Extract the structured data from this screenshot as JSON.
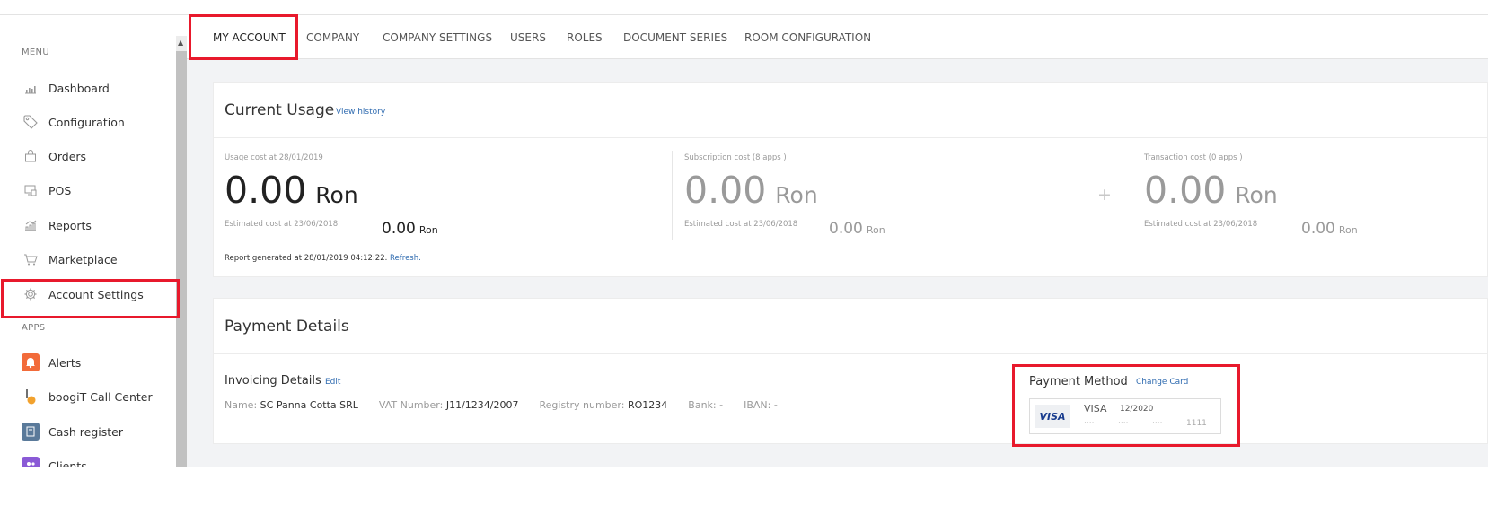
{
  "sidebar": {
    "menu_label": "MENU",
    "items": [
      {
        "label": "Dashboard",
        "icon": "bar-chart-icon"
      },
      {
        "label": "Configuration",
        "icon": "tag-icon"
      },
      {
        "label": "Orders",
        "icon": "shopping-bag-icon"
      },
      {
        "label": "POS",
        "icon": "pos-terminal-icon"
      },
      {
        "label": "Reports",
        "icon": "reports-chart-icon"
      },
      {
        "label": "Marketplace",
        "icon": "cart-icon"
      },
      {
        "label": "Account Settings",
        "icon": "gear-icon"
      }
    ],
    "apps_label": "APPS",
    "apps": [
      {
        "label": "Alerts",
        "icon": "bell-icon",
        "color": "#f26b3a"
      },
      {
        "label": "boogiT Call Center",
        "icon": "phone-icon",
        "color": "#f2a22e"
      },
      {
        "label": "Cash register",
        "icon": "cash-register-icon",
        "color": "#5a7a9a"
      },
      {
        "label": "Clients",
        "icon": "clients-icon",
        "color": "#8a5ad6"
      }
    ]
  },
  "tabs": [
    {
      "label": "MY ACCOUNT",
      "active": true
    },
    {
      "label": "COMPANY"
    },
    {
      "label": "COMPANY SETTINGS"
    },
    {
      "label": "USERS"
    },
    {
      "label": "ROLES"
    },
    {
      "label": "DOCUMENT SERIES"
    },
    {
      "label": "ROOM CONFIGURATION"
    }
  ],
  "usage": {
    "title": "Current Usage",
    "view_history": "View history",
    "usage_cost": {
      "label": "Usage cost at 28/01/2019",
      "value": "0.00",
      "currency": "Ron",
      "estimated_label": "Estimated cost at 23/06/2018",
      "estimated_value": "0.00",
      "estimated_currency": "Ron"
    },
    "subscription_cost": {
      "label": "Subscription cost (8 apps )",
      "value": "0.00",
      "currency": "Ron",
      "estimated_label": "Estimated cost at 23/06/2018",
      "estimated_value": "0.00",
      "estimated_currency": "Ron"
    },
    "plus_sign": "+",
    "transaction_cost": {
      "label": "Transaction cost (0 apps )",
      "value": "0.00",
      "currency": "Ron",
      "estimated_label": "Estimated cost at 23/06/2018",
      "estimated_value": "0.00",
      "estimated_currency": "Ron"
    },
    "report_generated": "Report generated at 28/01/2019 04:12:22.",
    "refresh": "Refresh."
  },
  "payment": {
    "title": "Payment Details",
    "invoicing_title": "Invoicing Details",
    "edit": "Edit",
    "name_key": "Name:",
    "name_val": "SC Panna Cotta SRL",
    "vat_key": "VAT Number:",
    "vat_val": "J11/1234/2007",
    "registry_key": "Registry number:",
    "registry_val": "RO1234",
    "bank_key": "Bank:",
    "bank_val": "-",
    "iban_key": "IBAN:",
    "iban_val": "-",
    "method_title": "Payment Method",
    "change_card": "Change Card",
    "card_brand_logo": "VISA",
    "card_brand": "VISA",
    "card_expiry": "12/2020",
    "card_groups": [
      "····",
      "····",
      "····",
      "1111"
    ]
  },
  "colors": {
    "highlight": "#e8192c",
    "link": "#2f6bb0"
  }
}
